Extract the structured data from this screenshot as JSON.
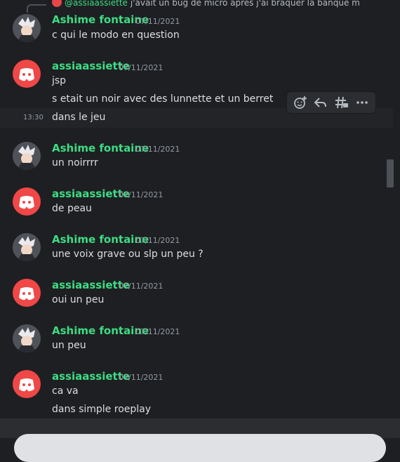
{
  "reply": {
    "user": "@assiaassiette",
    "text": "j'avait un bug de micro apres j'ai braquer la banque m..."
  },
  "messages": [
    {
      "user": "Ashime fontaine",
      "time": "07/11/2021",
      "lines": [
        "c qui le modo en question"
      ]
    },
    {
      "user": "assiaassiette",
      "time": "07/11/2021",
      "lines": [
        "jsp",
        "s etait un noir avec des lunnette et un berret",
        "dans le jeu"
      ]
    },
    {
      "user": "Ashime fontaine",
      "time": "07/11/2021",
      "lines": [
        "un noirrrr"
      ]
    },
    {
      "user": "assiaassiette",
      "time": "07/11/2021",
      "lines": [
        "de peau"
      ]
    },
    {
      "user": "Ashime fontaine",
      "time": "07/11/2021",
      "lines": [
        "une voix grave ou slp un peu ?"
      ]
    },
    {
      "user": "assiaassiette",
      "time": "07/11/2021",
      "lines": [
        "oui un peu"
      ]
    },
    {
      "user": "Ashime fontaine",
      "time": "07/11/2021",
      "lines": [
        "un peu"
      ]
    },
    {
      "user": "assiaassiette",
      "time": "07/11/2021",
      "lines": [
        "ca va",
        "dans simple roeplay"
      ]
    }
  ],
  "hover_time": "13:30",
  "toolbar": [
    "add-reaction-icon",
    "reply-icon",
    "create-thread-icon",
    "more-icon"
  ],
  "colors": {
    "username": "#3ddc84",
    "discord_avatar": "#f04747",
    "background": "#1e1f22"
  }
}
